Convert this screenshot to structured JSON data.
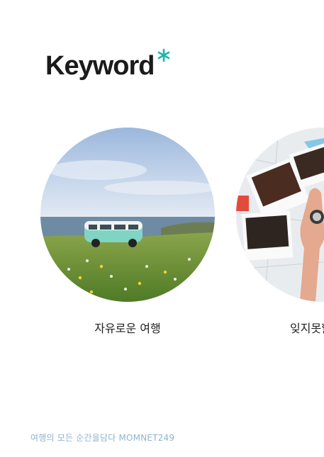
{
  "section": {
    "title": "Keyword",
    "accent_color": "#1fb5a9",
    "asterisk_icon": "asterisk-icon"
  },
  "cards": [
    {
      "caption": "자유로운 여행",
      "image": "van-meadow-photo"
    },
    {
      "caption": "잊지못할",
      "image": "polaroid-map-photo"
    }
  ],
  "footer": {
    "text": "여행의 모든 순간을담다 MOMNET249"
  }
}
